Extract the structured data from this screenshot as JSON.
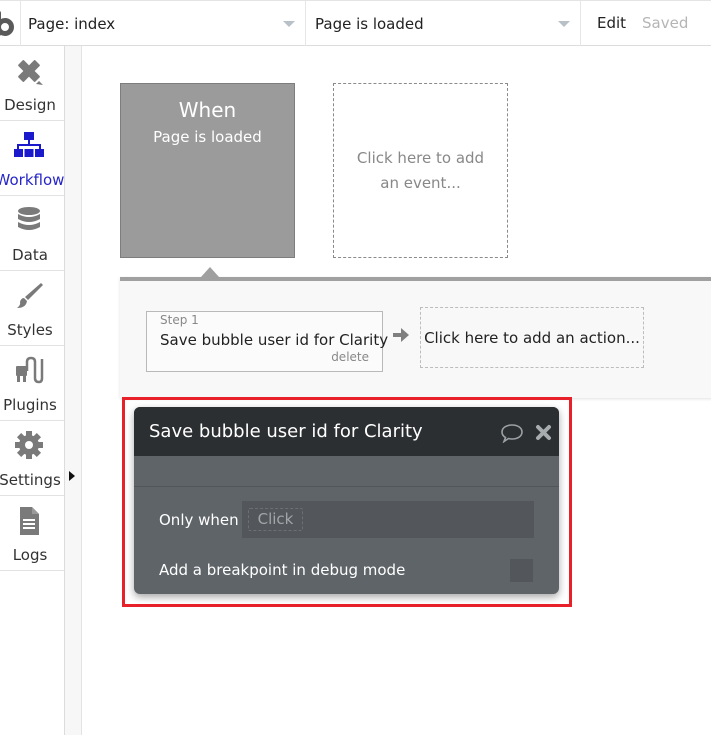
{
  "topbar": {
    "logo_icon": "bubble-logo-icon",
    "page_select": {
      "value": "Page: index",
      "icon": "caret-down-icon"
    },
    "event_select": {
      "value": "Page is loaded",
      "icon": "caret-down-icon"
    },
    "edit_label": "Edit",
    "save_status": "Saved"
  },
  "sidebar": {
    "items": [
      {
        "label": "Design",
        "icon": "design-tools-icon",
        "active": false
      },
      {
        "label": "Workflow",
        "icon": "workflow-tree-icon",
        "active": true
      },
      {
        "label": "Data",
        "icon": "database-icon",
        "active": false
      },
      {
        "label": "Styles",
        "icon": "paintbrush-icon",
        "active": false
      },
      {
        "label": "Plugins",
        "icon": "plug-icon",
        "active": false
      },
      {
        "label": "Settings",
        "icon": "gear-icon",
        "active": false
      },
      {
        "label": "Logs",
        "icon": "document-icon",
        "active": false
      }
    ],
    "expand_icon": "caret-right-icon"
  },
  "canvas": {
    "event": {
      "title": "When",
      "subtitle": "Page is loaded"
    },
    "add_event_text": "Click here to add an event...",
    "steps": [
      {
        "number_label": "Step 1",
        "title": "Save bubble user id for Clarity",
        "delete_label": "delete"
      }
    ],
    "step_arrow_icon": "arrow-right-icon",
    "add_action_text": "Click here to add an action..."
  },
  "property_editor": {
    "title": "Save bubble user id for Clarity",
    "comment_icon": "comment-bubble-icon",
    "close_icon": "close-icon",
    "only_when_label": "Only when",
    "only_when_placeholder": "Click",
    "breakpoint_label": "Add a breakpoint in debug mode",
    "breakpoint_checked": false,
    "highlight_color": "#e8202a"
  },
  "colors": {
    "accent_active": "#2626c8",
    "event_box": "#9b9b9b",
    "editor_header": "#2b2f32",
    "editor_body": "#5f6468"
  }
}
